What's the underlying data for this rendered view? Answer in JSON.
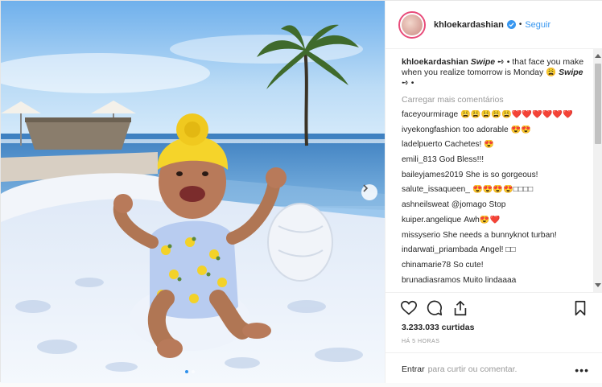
{
  "photo": {
    "colors": {
      "sky": "#8fc3f0",
      "sea": "#4f8fc8",
      "towel": "#eef3fb",
      "turban": "#f5d42a",
      "skin": "#b87a5a"
    },
    "carousel_index": 1,
    "carousel_total": 2
  },
  "header": {
    "username": "khloekardashian",
    "verified": true,
    "separator": "•",
    "follow_label": "Seguir"
  },
  "caption": {
    "username": "khloekardashian",
    "emph1": "Swipe",
    "mid": " ➺ • that face you make when you realize tomorrow is Monday 😩 ",
    "emph2": "Swipe",
    "end": " ➺ •"
  },
  "load_more": "Carregar mais comentários",
  "comments": [
    {
      "user": "faceyourmirage",
      "text": "😩😩😩😩😩❤️❤️❤️❤️❤️❤️"
    },
    {
      "user": "ivyekongfashion",
      "text": "too adorable 😍😍"
    },
    {
      "user": "ladelpuerto",
      "text": "Cachetes! 😍"
    },
    {
      "user": "emili_813",
      "text": "God Bless!!!"
    },
    {
      "user": "baileyjames2019",
      "text": "She is so gorgeous!"
    },
    {
      "user": "salute_issaqueen_",
      "text": "😍😍😍😍□□□□"
    },
    {
      "user": "ashneilsweat",
      "text": "@jomago Stop"
    },
    {
      "user": "kuiper.angelique",
      "text": "Awh😍❤️"
    },
    {
      "user": "missyserio",
      "text": "She needs a bunnyknot turban!"
    },
    {
      "user": "indarwati_priambada",
      "text": "Angel! □□"
    },
    {
      "user": "chinamarie78",
      "text": "So cute!"
    },
    {
      "user": "brunadiasramos",
      "text": "Muito lindaaaa"
    }
  ],
  "likes": "3.233.033 curtidas",
  "time_ago": "HÁ 5 HORAS",
  "add_comment": {
    "enter_label": "Entrar",
    "placeholder": "para curtir ou comentar."
  },
  "more_label": "•••",
  "icons": [
    "heart-icon",
    "comment-icon",
    "share-icon",
    "bookmark-icon",
    "verified-badge-icon",
    "chevron-right-icon"
  ]
}
